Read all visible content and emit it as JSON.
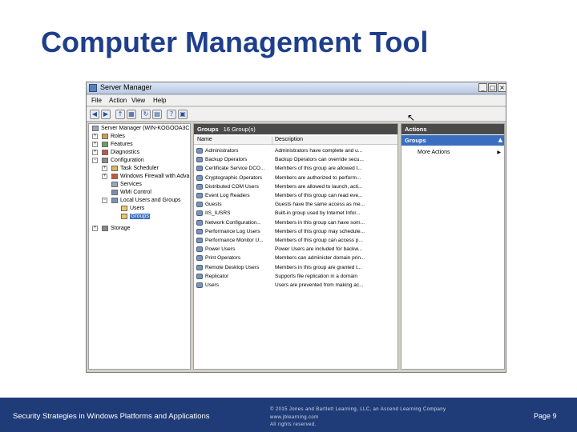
{
  "slide": {
    "title": "Computer Management Tool"
  },
  "window": {
    "title": "Server Manager",
    "controls": {
      "minimize": "_",
      "maximize": "□",
      "close": "×"
    },
    "menu": [
      "File",
      "Action",
      "View",
      "Help"
    ]
  },
  "tree": {
    "items": [
      {
        "label": "Server Manager (WIN-KOGOOA3C"
      },
      {
        "label": "Roles"
      },
      {
        "label": "Features"
      },
      {
        "label": "Diagnostics"
      },
      {
        "label": "Configuration"
      },
      {
        "label": "Task Scheduler"
      },
      {
        "label": "Windows Firewall with Adva"
      },
      {
        "label": "Services"
      },
      {
        "label": "WMI Control"
      },
      {
        "label": "Local Users and Groups"
      },
      {
        "label": "Users"
      },
      {
        "label": "Groups"
      },
      {
        "label": "Storage"
      }
    ]
  },
  "center": {
    "header_title": "Groups",
    "header_count": "16 Group(s)",
    "columns": {
      "name": "Name",
      "description": "Description"
    },
    "rows": [
      {
        "name": "Administrators",
        "description": "Administrators have complete and u..."
      },
      {
        "name": "Backup Operators",
        "description": "Backup Operators can override secu..."
      },
      {
        "name": "Certificate Service DCO...",
        "description": "Members of this group are allowed t..."
      },
      {
        "name": "Cryptographic Operators",
        "description": "Members are authorized to perform..."
      },
      {
        "name": "Distributed COM Users",
        "description": "Members are allowed to launch, acti..."
      },
      {
        "name": "Event Log Readers",
        "description": "Members of this group can read eve..."
      },
      {
        "name": "Guests",
        "description": "Guests have the same access as me..."
      },
      {
        "name": "IIS_IUSRS",
        "description": "Built-in group used by Internet Infor..."
      },
      {
        "name": "Network Configuration...",
        "description": "Members in this group can have som..."
      },
      {
        "name": "Performance Log Users",
        "description": "Members of this group may schedule..."
      },
      {
        "name": "Performance Monitor U...",
        "description": "Members of this group can access p..."
      },
      {
        "name": "Power Users",
        "description": "Power Users are included for backw..."
      },
      {
        "name": "Print Operators",
        "description": "Members can administer domain prin..."
      },
      {
        "name": "Remote Desktop Users",
        "description": "Members in this group are granted t..."
      },
      {
        "name": "Replicator",
        "description": "Supports file replication in a domain"
      },
      {
        "name": "Users",
        "description": "Users are prevented from making ac..."
      }
    ]
  },
  "actions": {
    "header": "Actions",
    "section": "Groups",
    "item": "More Actions"
  },
  "footer": {
    "course": "Security Strategies in Windows Platforms and Applications",
    "copyright_line1": "© 2015 Jones and Bartlett Learning, LLC, an Ascend Learning Company",
    "copyright_line2": "www.jblearning.com",
    "copyright_line3": "All rights reserved.",
    "page": "Page 9"
  },
  "colors": {
    "title_blue": "#1f3f8c",
    "footer_navy": "#1f3c78",
    "pane_header": "#4a4a4a",
    "selection_blue": "#3a6fbf"
  }
}
